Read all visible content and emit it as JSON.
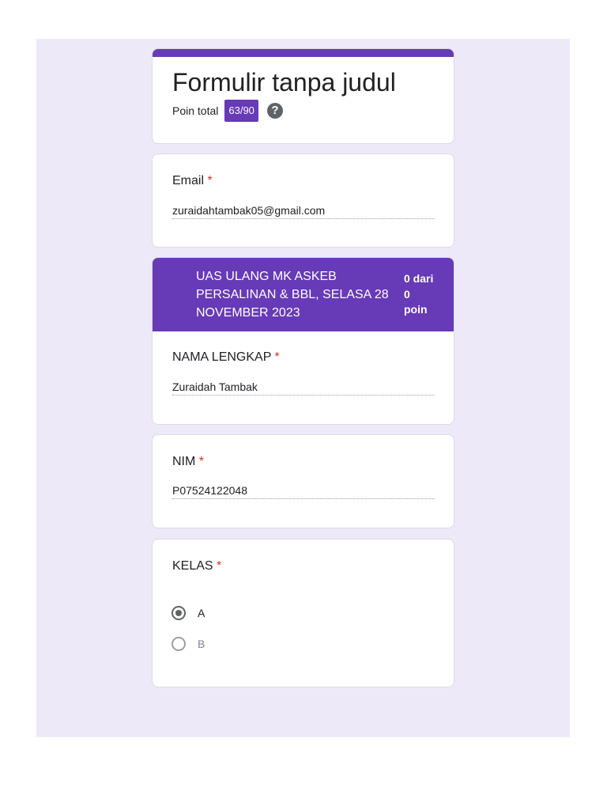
{
  "form": {
    "title": "Formulir tanpa judul",
    "points_label": "Poin total",
    "points_value": "63/90",
    "help_icon": "help-circle-icon",
    "accent_color": "#673ab7",
    "background_color": "#ede9f8"
  },
  "email": {
    "label": "Email",
    "required_mark": "*",
    "value": "zuraidahtambak05@gmail.com"
  },
  "section": {
    "title": "UAS ULANG MK ASKEB PERSALINAN & BBL, SELASA 28 NOVEMBER 2023",
    "score_line1": "0 dari",
    "score_line2": "0",
    "score_line3": "poin"
  },
  "nama": {
    "label": "NAMA LENGKAP",
    "required_mark": "*",
    "value": "Zuraidah Tambak"
  },
  "nim": {
    "label": "NIM",
    "required_mark": "*",
    "value": "P07524122048"
  },
  "kelas": {
    "label": "KELAS",
    "required_mark": "*",
    "options": [
      {
        "label": "A",
        "selected": true
      },
      {
        "label": "B",
        "selected": false
      }
    ]
  }
}
